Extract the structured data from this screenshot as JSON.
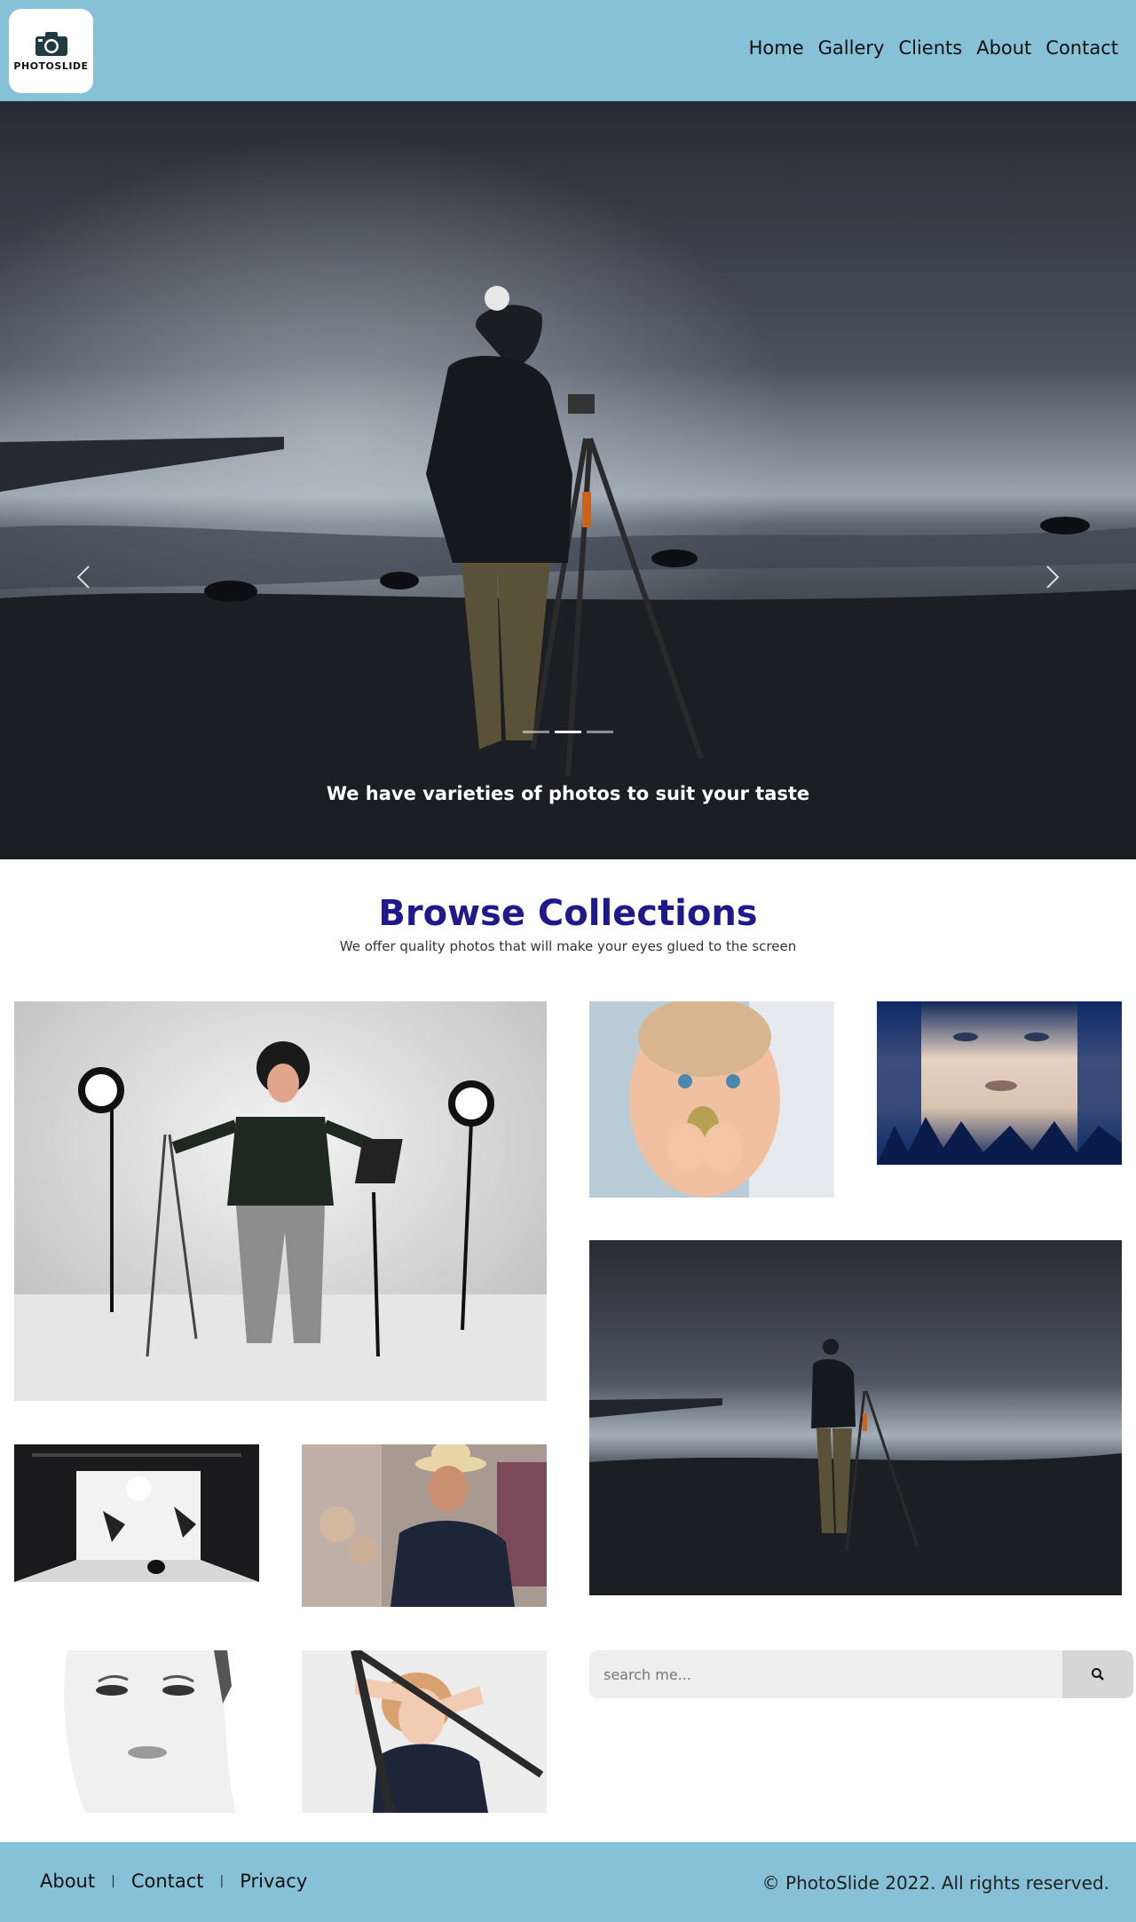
{
  "header": {
    "logo_text": "PHOTOSLIDE",
    "nav": [
      "Home",
      "Gallery",
      "Clients",
      "About",
      "Contact"
    ]
  },
  "hero": {
    "caption": "We have varieties of photos to suit your taste",
    "slide_count": 3,
    "active_slide": 2
  },
  "collections": {
    "title": "Browse Collections",
    "subtitle": "We offer quality photos that will make your eyes glued to the screen"
  },
  "search": {
    "placeholder": "search me..."
  },
  "footer": {
    "links": [
      "About",
      "Contact",
      "Privacy"
    ],
    "copyright": "© PhotoSlide 2022. All rights reserved."
  },
  "colors": {
    "header_bg": "#86c1d7",
    "title": "#1e1a8a"
  }
}
